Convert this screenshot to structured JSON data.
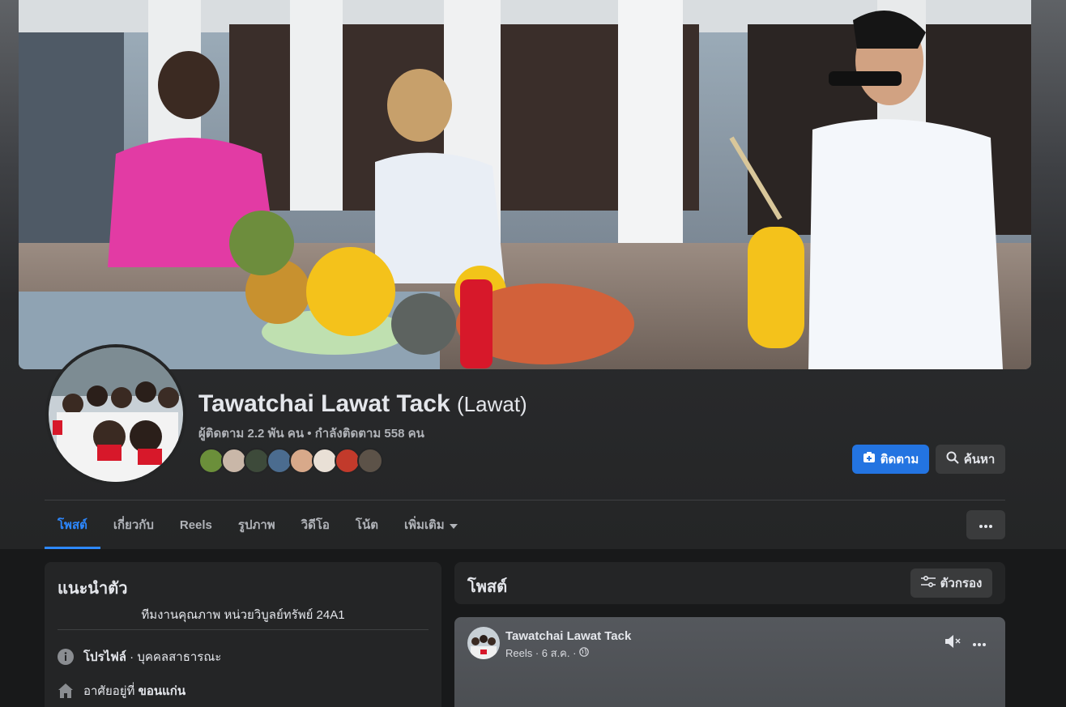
{
  "profile": {
    "name": "Tawatchai Lawat Tack",
    "alt_name": "(Lawat)",
    "stats": "ผู้ติดตาม 2.2 พัน คน • กำลังติดตาม 558 คน"
  },
  "followers_preview_colors": [
    "#6b8f3a",
    "#c9b7a8",
    "#3d4a3a",
    "#4b6c8f",
    "#d8a98a",
    "#e9e0d6",
    "#c23a2b",
    "#5c5248"
  ],
  "actions": {
    "follow_label": "ติดตาม",
    "search_label": "ค้นหา"
  },
  "tabs": [
    {
      "label": "โพสต์"
    },
    {
      "label": "เกี่ยวกับ"
    },
    {
      "label": "Reels"
    },
    {
      "label": "รูปภาพ"
    },
    {
      "label": "วิดีโอ"
    },
    {
      "label": "โน้ต"
    },
    {
      "label": "เพิ่มเติม"
    }
  ],
  "intro": {
    "title": "แนะนำตัว",
    "bio": "ทีมงานคุณภาพ หน่วยวิบูลย์ทรัพย์ 24A1",
    "profile_label": "โปรไฟล์",
    "profile_type": " · บุคคลสาธารณะ",
    "lives_label": "อาศัยอยู่ที่ ",
    "lives_value": "ขอนแก่น"
  },
  "posts": {
    "title": "โพสต์",
    "filter_label": "ตัวกรอง",
    "items": [
      {
        "author": "Tawatchai Lawat Tack",
        "meta": "Reels · 6 ส.ค. ·"
      }
    ]
  },
  "colors": {
    "accent": "#2d88ff",
    "primary_button": "#2374e1",
    "card_bg": "#242526",
    "page_bg": "#18191a"
  }
}
